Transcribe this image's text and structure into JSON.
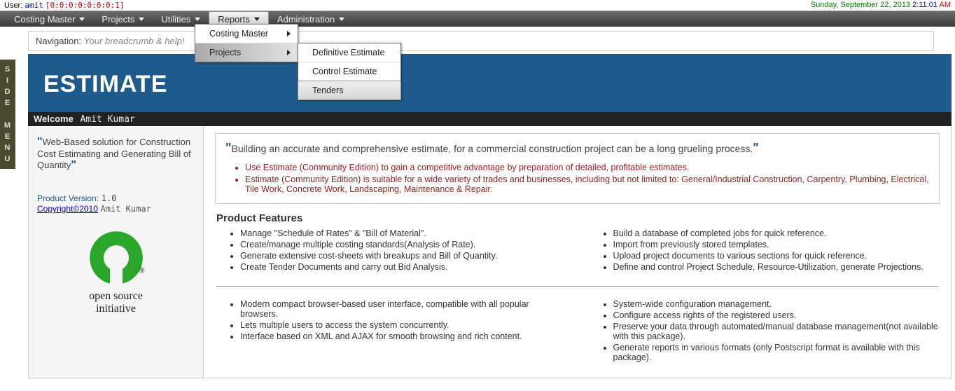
{
  "topbar": {
    "user_label": "User:",
    "user_name": "amit",
    "user_ip": "[0:0:0:0:0:0:0:1]",
    "date": "Sunday, September 22, 2013",
    "time_blue": "2:11:01",
    "time_red": "AM"
  },
  "menubar": {
    "items": [
      "Costing Master",
      "Projects",
      "Utilities",
      "Reports",
      "Administration"
    ],
    "active_index": 3
  },
  "dropdown": {
    "items": [
      {
        "label": "Costing Master",
        "has_sub": true,
        "highlight": false
      },
      {
        "label": "Projects",
        "has_sub": true,
        "highlight": true
      }
    ]
  },
  "submenu": {
    "items": [
      {
        "label": "Definitive Estimate",
        "hovered": false
      },
      {
        "label": "Control Estimate",
        "hovered": false
      },
      {
        "label": "Tenders",
        "hovered": true
      }
    ]
  },
  "side_tab": {
    "chars": [
      "S",
      "I",
      "D",
      "E",
      "",
      "M",
      "E",
      "N",
      "U"
    ]
  },
  "nav": {
    "label": "Navigation:",
    "breadcrumb": "Your breadcrumb & help!"
  },
  "banner": {
    "title": "ESTIMATE"
  },
  "welcome": {
    "label": "Welcome",
    "user": "Amit Kumar"
  },
  "side_panel": {
    "tagline": "Web-Based solution for Construction Cost Estimating and Generating Bill of Quantity",
    "pv_label": "Product Version:",
    "pv_value": "1.0",
    "copyright": "Copyright©2010",
    "author": "Amit Kumar",
    "osi_label1": "open source",
    "osi_label2": "initiative"
  },
  "main": {
    "quote": "Building an accurate and comprehensive estimate, for a commercial construction project can be a long grueling process.",
    "quote_bullets": [
      "Use Estimate (Community Edition) to gain a competitive advantage by preparation of detailed, profitable estimates.",
      "Estimate (Community Edition) is suitable for a wide variety of trades and businesses, including but not limited to: General/Industrial Construction, Carpentry, Plumbing, Electrical, Tile Work, Concrete Work, Landscaping, Maintenance & Repair."
    ],
    "features_heading": "Product Features",
    "feat_left1": [
      "Manage \"Schedule of Rates\" & \"Bill of Material\".",
      "Create/manage multiple costing standards(Analysis of Rate).",
      "Generate extensive cost-sheets with breakups and Bill of Quantity.",
      "Create Tender Documents and carry out Bid Analysis."
    ],
    "feat_right1": [
      "Build a database of completed jobs for quick reference.",
      "Import from previously stored templates.",
      "Upload project documents to various sections for quick reference.",
      "Define and control Project Schedule, Resource-Utilization, generate Projections."
    ],
    "feat_left2": [
      "Modern compact browser-based user interface, compatible with all popular browsers.",
      "Lets multiple users to access the system concurrently.",
      "Interface based on XML and AJAX for smooth browsing and rich content."
    ],
    "feat_right2": [
      "System-wide configuration management.",
      "Configure access rights of the registered users.",
      "Preserve your data through automated/manual database management(not available with this package).",
      "Generate reports in various formats (only Postscript format is available with this package)."
    ]
  }
}
